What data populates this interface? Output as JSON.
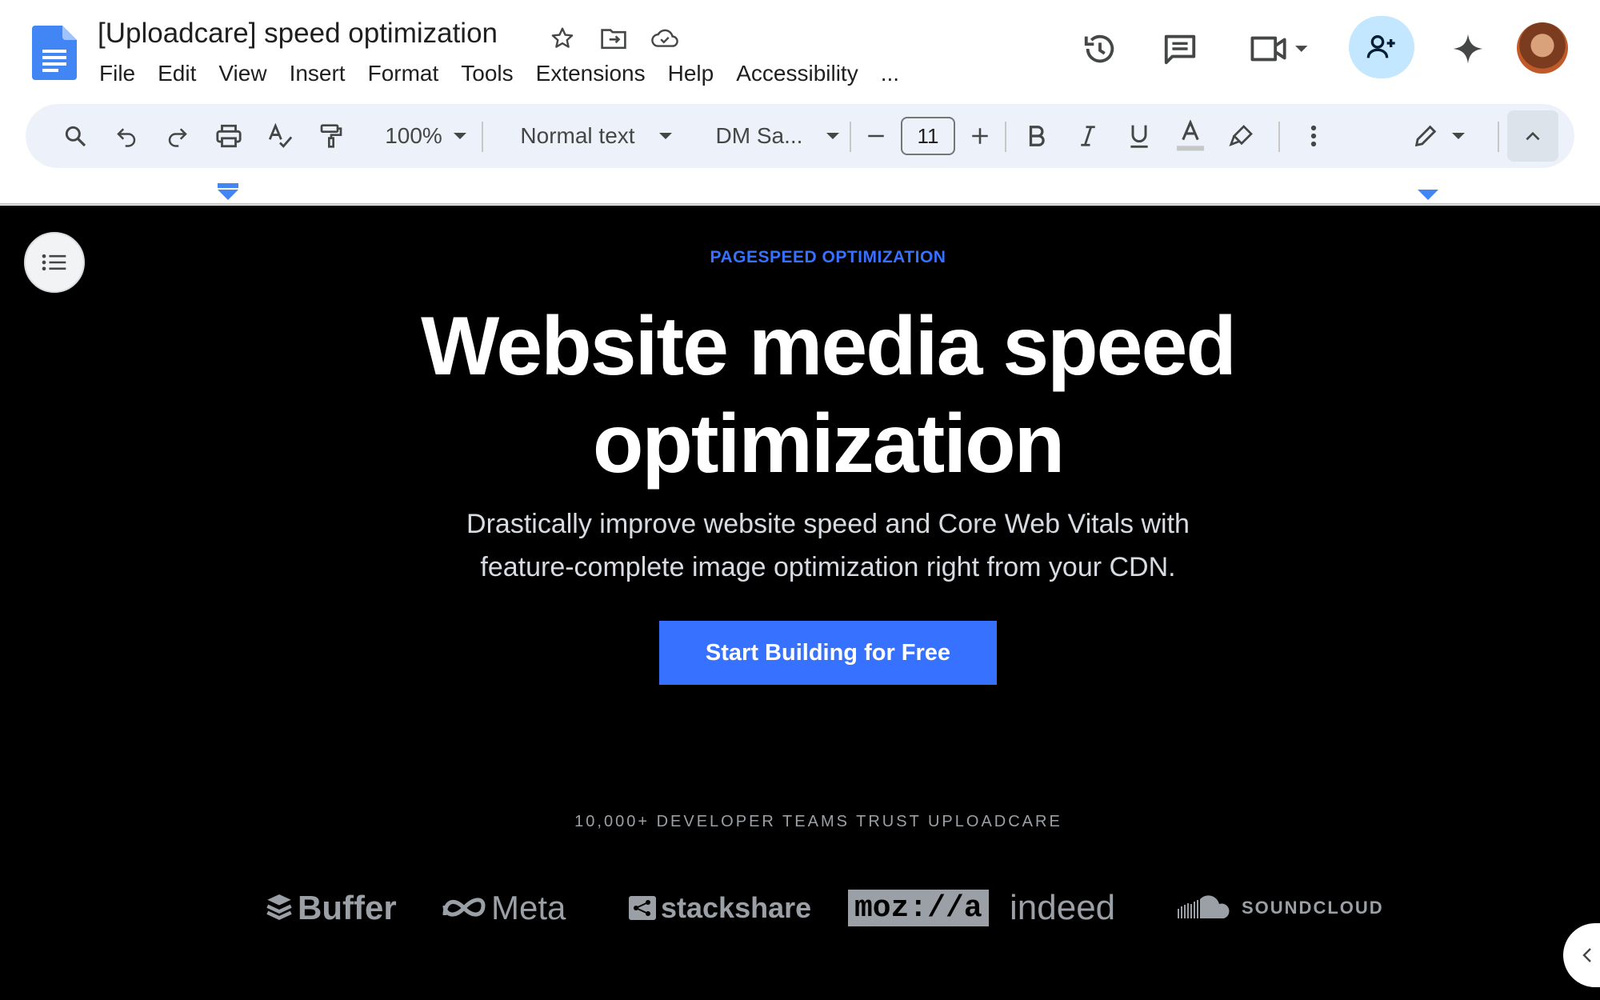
{
  "app": {
    "document_title": "[Uploadcare] speed optimization",
    "menu": [
      "File",
      "Edit",
      "View",
      "Insert",
      "Format",
      "Tools",
      "Extensions",
      "Help",
      "Accessibility",
      "..."
    ]
  },
  "toolbar": {
    "zoom": "100%",
    "paragraph_style": "Normal text",
    "font_family": "DM Sa...",
    "font_size": "11",
    "text_color": "#444746"
  },
  "document": {
    "eyebrow": "PAGESPEED OPTIMIZATION",
    "headline_line1": "Website media speed",
    "headline_line2": "optimization",
    "subline_line1": "Drastically improve website speed and Core Web Vitals with",
    "subline_line2": "feature-complete image optimization right from your CDN.",
    "cta_label": "Start Building for Free",
    "trust_line": "10,000+ DEVELOPER TEAMS TRUST UPLOADCARE",
    "logos": [
      "Buffer",
      "Meta",
      "stackshare",
      "moz://a",
      "indeed",
      "SOUNDCLOUD"
    ]
  },
  "colors": {
    "accent_blue": "#3771ff",
    "hero_background": "#000000",
    "share_button_bg": "#c2e7ff",
    "toolbar_bg": "#edf2fa"
  },
  "icons": {
    "top_right": [
      "version-history-icon",
      "comments-icon",
      "meet-icon",
      "share-add-person-icon",
      "gemini-sparkle-icon"
    ],
    "title": [
      "star-icon",
      "move-folder-icon",
      "cloud-saved-icon"
    ]
  }
}
